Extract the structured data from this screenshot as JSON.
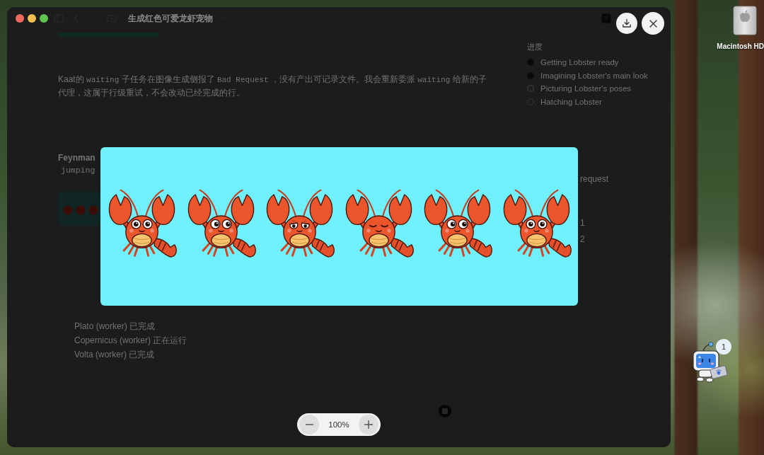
{
  "window": {
    "title": "生成红色可爱龙虾宠物"
  },
  "thread": {
    "message": [
      {
        "text": "Kaat的 ",
        "code": false
      },
      {
        "text": "waiting",
        "code": true
      },
      {
        "text": " 子任务在图像生成侧报了 ",
        "code": false
      },
      {
        "text": "Bad Request",
        "code": true
      },
      {
        "text": " ，没有产出可记录文件。我会重新委派 ",
        "code": false
      },
      {
        "text": "waiting",
        "code": true
      },
      {
        "text": " 给新的子代理，这属于行级重试，不会改动已经完成的行。",
        "code": false
      }
    ],
    "author": "Feynman",
    "code_line": "jumping",
    "workers": [
      {
        "label": "Plato (worker) 已完成"
      },
      {
        "label": "Copernicus (worker) 正在运行"
      },
      {
        "label": "Volta (worker) 已完成"
      }
    ]
  },
  "progress": {
    "heading": "进度",
    "steps": [
      {
        "label": "Getting Lobster ready",
        "kind": "done"
      },
      {
        "label": "Imagining Lobster's main look",
        "kind": "done"
      },
      {
        "label": "Picturing Lobster's poses",
        "kind": "active"
      },
      {
        "label": "Hatching Lobster",
        "kind": "pending"
      }
    ]
  },
  "side_fragments": [
    "request",
    "1",
    "2"
  ],
  "viewer": {
    "zoom": "100%"
  },
  "desktop": {
    "drive_label": "Macintosh HD",
    "notification_count": "1"
  }
}
